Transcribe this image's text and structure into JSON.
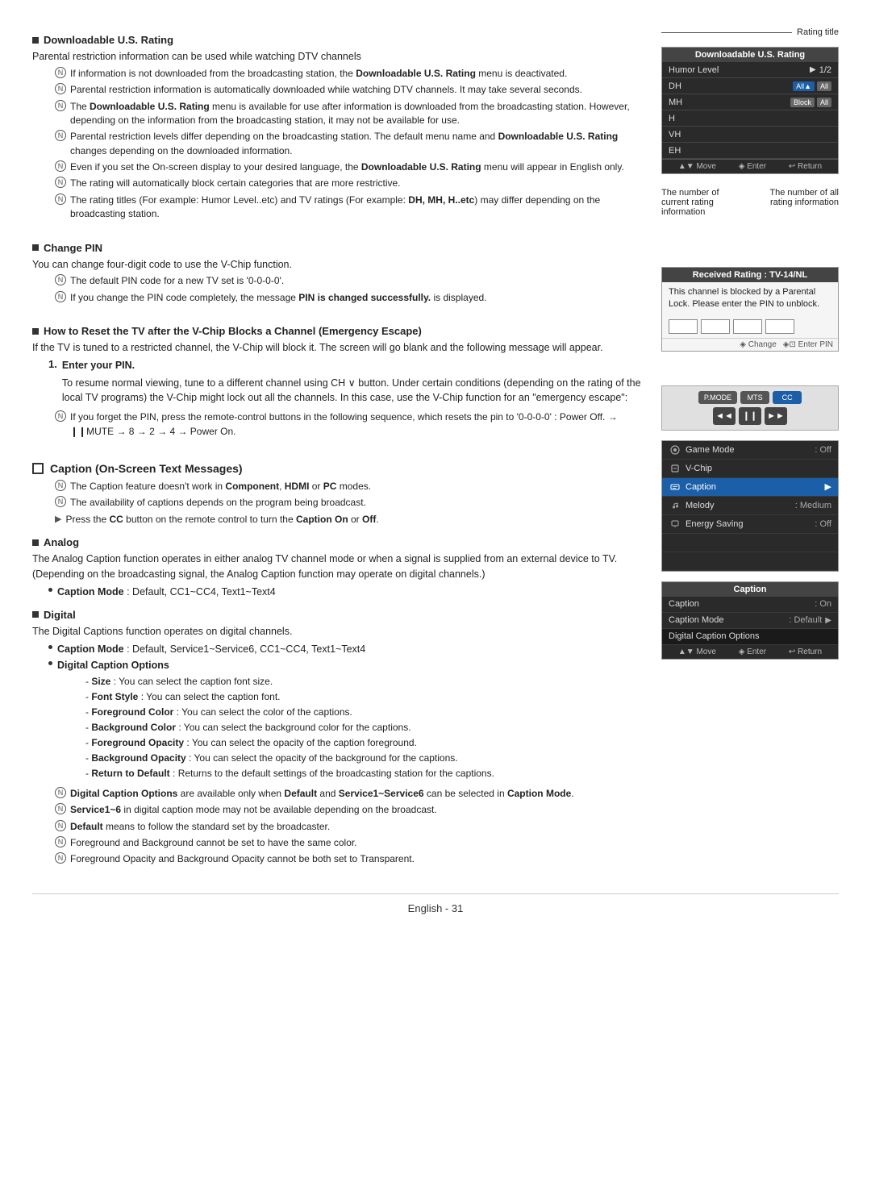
{
  "page": {
    "footer": "English - 31"
  },
  "sections": {
    "downloadable_rating": {
      "title": "Downloadable U.S. Rating",
      "body": "Parental restriction information can be used while watching DTV channels",
      "notes": [
        "If information is not downloaded from the broadcasting station, the Downloadable U.S. Rating menu is deactivated.",
        "Parental restriction information is automatically downloaded while watching DTV channels. It may take several seconds.",
        "The Downloadable U.S. Rating menu is available for use after information is downloaded from the broadcasting station. However, depending on the information from the broadcasting station, it may not be available for use.",
        "Parental restriction levels differ depending on the broadcasting station. The default menu name and Downloadable U.S. Rating changes depending on the downloaded information.",
        "Even if you set the On-screen display to your desired language, the Downloadable U.S. Rating menu will appear in English only.",
        "The rating will automatically block certain categories that are more restrictive.",
        "The rating titles (For example: Humor Level..etc) and TV ratings (For example: DH, MH, H..etc) may differ depending on the broadcasting station."
      ]
    },
    "change_pin": {
      "title": "Change PIN",
      "body": "You can change four-digit code to use the V-Chip function.",
      "notes": [
        "The default PIN code for a new TV set is '0-0-0-0'.",
        "If you change the PIN code completely, the message PIN is changed successfully. is displayed."
      ]
    },
    "emergency_escape": {
      "title": "How to Reset the TV after the V-Chip Blocks a Channel (Emergency Escape)",
      "intro": "If the TV is tuned to a restricted channel, the V-Chip will block it. The screen will go blank and the following message will appear.",
      "step1_label": "1.",
      "step1_title": "Enter your PIN.",
      "step1_body": "To resume normal viewing, tune to a different channel using CH ∨ button. Under certain conditions (depending on the rating of the local TV programs) the V-Chip might lock out all the channels. In this case, use the V-Chip function for an \"emergency escape\":",
      "note1": "If you forget the PIN, press the remote-control buttons in the following sequence, which resets the pin to '0-0-0-0' : Power Off. → ❙❙MUTE → 8 → 2 → 4 → Power On."
    },
    "caption": {
      "title": "Caption (On-Screen Text Messages)",
      "notes": [
        "The Caption feature doesn't work in Component, HDMI or PC modes.",
        "The availability of captions depends on the program being broadcast."
      ],
      "note_special": "Press the CC button on the remote control to turn the Caption On or Off.",
      "analog": {
        "title": "Analog",
        "body": "The Analog Caption function operates in either analog TV channel mode or when a signal is supplied from an external device to TV. (Depending on the broadcasting signal, the Analog Caption function may operate on digital channels.)",
        "bullet": "Caption Mode : Default, CC1~CC4, Text1~Text4"
      },
      "digital": {
        "title": "Digital",
        "body": "The Digital Captions function operates on digital channels.",
        "bullets": [
          "Caption Mode : Default, Service1~Service6, CC1~CC4, Text1~Text4",
          "Digital Caption Options"
        ],
        "dashes": [
          "Size : You can select the caption font size.",
          "Font Style : You can select the caption font.",
          "Foreground Color : You can select the color of the captions.",
          "Background Color : You can select the background color for the captions.",
          "Foreground Opacity : You can select the opacity of the caption foreground.",
          "Background Opacity : You can select the opacity of the background for the captions.",
          "Return to Default : Returns to the default settings of the broadcasting station for the captions."
        ],
        "bottom_notes": [
          "Digital Caption Options are available only when Default and Service1~Service6 can be selected in Caption Mode.",
          "Service1~6 in digital caption mode may not be available depending on the broadcast.",
          "Default means to follow the standard set by the broadcaster.",
          "Foreground and Background cannot be set to have the same color.",
          "Foreground Opacity and Background Opacity cannot be both set to Transparent."
        ]
      }
    }
  },
  "ui_panels": {
    "rating_title_label": "Rating title",
    "rating_panel": {
      "title": "Downloadable U.S. Rating",
      "humor_level": "Humor Level",
      "value": "1/2",
      "items": [
        "DH",
        "MH",
        "H",
        "VH",
        "EH"
      ],
      "btn_all1": "All▲",
      "btn_all2": "All",
      "btn_block": "Block",
      "btn_block2": "All",
      "footer": [
        "▲▼ Move",
        "◈ Enter",
        "↩ Return"
      ]
    },
    "rating_info": {
      "left": "The number of current rating information",
      "right": "The number of all rating information"
    },
    "emergency_panel": {
      "title": "Received Rating : TV-14/NL",
      "body": "This channel is blocked by a Parental Lock. Please enter the PIN to unblock.",
      "footer_left": "◈ Change",
      "footer_right": "◈⊡ Enter PIN"
    },
    "remote": {
      "buttons_top": [
        "P.MODE",
        "MTS",
        "CC"
      ],
      "buttons_bottom": [
        "◄◄",
        "❙❙",
        "►►"
      ]
    },
    "setup_menu": {
      "rows": [
        {
          "icon": "gear",
          "label": "Game Mode",
          "value": ": Off"
        },
        {
          "icon": "gear",
          "label": "V-Chip",
          "value": ""
        },
        {
          "icon": "gear",
          "label": "Caption",
          "value": "",
          "highlighted": true
        },
        {
          "icon": "speaker",
          "label": "Melody",
          "value": ": Medium"
        },
        {
          "icon": "screen",
          "label": "Energy Saving",
          "value": ": Off"
        },
        {
          "icon": "blank",
          "label": "",
          "value": ""
        },
        {
          "icon": "blank2",
          "label": "",
          "value": ""
        }
      ]
    },
    "caption_panel": {
      "title": "Caption",
      "rows": [
        {
          "label": "Caption",
          "value": ": On"
        },
        {
          "label": "Caption Mode",
          "value": ": Default",
          "arrow": true
        },
        {
          "label": "Digital Caption Options",
          "value": ""
        }
      ],
      "footer": [
        "▲▼ Move",
        "◈ Enter",
        "↩ Return"
      ]
    }
  }
}
